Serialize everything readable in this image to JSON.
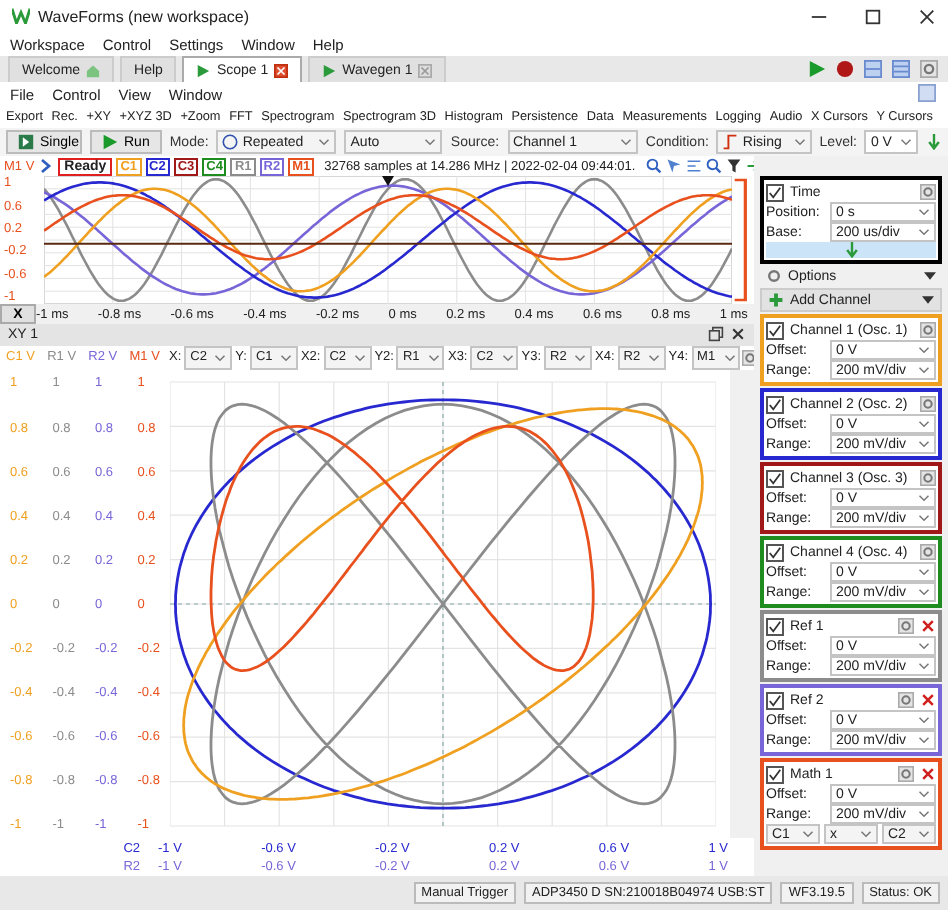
{
  "window": {
    "title": "WaveForms (new workspace)"
  },
  "menu": [
    "Workspace",
    "Control",
    "Settings",
    "Window",
    "Help"
  ],
  "tabs": [
    {
      "label": "Welcome",
      "kind": "home",
      "selected": false
    },
    {
      "label": "Help",
      "kind": "plain",
      "selected": false
    },
    {
      "label": "Scope 1",
      "kind": "instrument",
      "selected": true
    },
    {
      "label": "Wavegen 1",
      "kind": "instrument",
      "selected": false
    }
  ],
  "scope_menu": [
    "File",
    "Control",
    "View",
    "Window"
  ],
  "toolbar": [
    "Export",
    "Rec.",
    "+XY",
    "+XYZ 3D",
    "+Zoom",
    "FFT",
    "Spectrogram",
    "Spectrogram 3D",
    "Histogram",
    "Persistence",
    "Data",
    "Measurements",
    "Logging",
    "Audio",
    "X Cursors",
    "Y Cursors"
  ],
  "controls": {
    "single": "Single",
    "run": "Run",
    "mode_label": "Mode:",
    "mode": "Repeated",
    "trigger": "Auto",
    "source_label": "Source:",
    "source": "Channel 1",
    "condition_label": "Condition:",
    "condition": "Rising",
    "level_label": "Level:",
    "level": "0 V"
  },
  "channel_bar": {
    "axis_label": "M1 V",
    "state": "Ready",
    "info": "32768 samples at 14.286 MHz | 2022-02-04 09:44:01.",
    "channels": [
      {
        "label": "C1",
        "color": "#f0a020"
      },
      {
        "label": "C2",
        "color": "#2828d0"
      },
      {
        "label": "C3",
        "color": "#a01818"
      },
      {
        "label": "C4",
        "color": "#1e8c1e"
      },
      {
        "label": "R1",
        "color": "#8c8c8c"
      },
      {
        "label": "R2",
        "color": "#7866d8"
      },
      {
        "label": "M1",
        "color": "#e8501e"
      }
    ]
  },
  "scope": {
    "y_ticks": [
      "1",
      "0.6",
      "0.2",
      "-0.2",
      "-0.6",
      "-1"
    ],
    "x_axis_button": "X",
    "x_ticks": [
      "-1 ms",
      "-0.8 ms",
      "-0.6 ms",
      "-0.4 ms",
      "-0.2 ms",
      "0 ms",
      "0.2 ms",
      "0.4 ms",
      "0.6 ms",
      "0.8 ms",
      "1 ms"
    ]
  },
  "xy": {
    "title": "XY 1",
    "y_columns": [
      {
        "label": "C1 V",
        "color": "#f0a020",
        "ticks": [
          "1",
          "0.8",
          "0.6",
          "0.4",
          "0.2",
          "0",
          "-0.2",
          "-0.4",
          "-0.6",
          "-0.8",
          "-1"
        ]
      },
      {
        "label": "R1 V",
        "color": "#8c8c8c",
        "ticks": [
          "1",
          "0.8",
          "0.6",
          "0.4",
          "0.2",
          "0",
          "-0.2",
          "-0.4",
          "-0.6",
          "-0.8",
          "-1"
        ]
      },
      {
        "label": "R2 V",
        "color": "#7866d8",
        "ticks": [
          "1",
          "0.8",
          "0.6",
          "0.4",
          "0.2",
          "0",
          "-0.2",
          "-0.4",
          "-0.6",
          "-0.8",
          "-1"
        ]
      },
      {
        "label": "M1 V",
        "color": "#e8501e",
        "ticks": [
          "1",
          "0.8",
          "0.6",
          "0.4",
          "0.2",
          "0",
          "-0.2",
          "-0.4",
          "-0.6",
          "-0.8",
          "-1"
        ]
      }
    ],
    "selectors": [
      {
        "label": "X:",
        "value": "C2"
      },
      {
        "label": "Y:",
        "value": "C1"
      },
      {
        "label": "X2:",
        "value": "C2"
      },
      {
        "label": "Y2:",
        "value": "R1"
      },
      {
        "label": "X3:",
        "value": "C2"
      },
      {
        "label": "Y3:",
        "value": "R2"
      },
      {
        "label": "X4:",
        "value": "R2"
      },
      {
        "label": "Y4:",
        "value": "M1"
      }
    ],
    "x_axes": [
      {
        "label": "C2",
        "color": "#2828d0",
        "ticks": [
          "-1 V",
          "-0.6 V",
          "-0.2 V",
          "0.2 V",
          "0.6 V",
          "1 V"
        ]
      },
      {
        "label": "R2",
        "color": "#7866d8",
        "ticks": [
          "-1 V",
          "-0.6 V",
          "-0.2 V",
          "0.2 V",
          "0.6 V",
          "1 V"
        ]
      }
    ]
  },
  "panel": {
    "time": {
      "title": "Time",
      "checked": true,
      "position_label": "Position:",
      "position": "0 s",
      "base_label": "Base:",
      "base": "200 us/div"
    },
    "options": "Options",
    "add_channel": "Add Channel",
    "channels": [
      {
        "kind": "channel",
        "title": "Channel 1 (Osc. 1)",
        "checked": true,
        "color": "#f0a020",
        "offset_label": "Offset:",
        "offset": "0 V",
        "range_label": "Range:",
        "range": "200 mV/div"
      },
      {
        "kind": "channel",
        "title": "Channel 2 (Osc. 2)",
        "checked": true,
        "color": "#2828d0",
        "offset_label": "Offset:",
        "offset": "0 V",
        "range_label": "Range:",
        "range": "200 mV/div"
      },
      {
        "kind": "channel",
        "title": "Channel 3 (Osc. 3)",
        "checked": true,
        "color": "#a01818",
        "offset_label": "Offset:",
        "offset": "0 V",
        "range_label": "Range:",
        "range": "200 mV/div"
      },
      {
        "kind": "channel",
        "title": "Channel 4 (Osc. 4)",
        "checked": true,
        "color": "#1e8c1e",
        "offset_label": "Offset:",
        "offset": "0 V",
        "range_label": "Range:",
        "range": "200 mV/div"
      },
      {
        "kind": "ref",
        "title": "Ref 1",
        "checked": true,
        "color": "#8c8c8c",
        "offset_label": "Offset:",
        "offset": "0 V",
        "range_label": "Range:",
        "range": "200 mV/div"
      },
      {
        "kind": "ref",
        "title": "Ref 2",
        "checked": true,
        "color": "#7866d8",
        "offset_label": "Offset:",
        "offset": "0 V",
        "range_label": "Range:",
        "range": "200 mV/div"
      },
      {
        "kind": "math",
        "title": "Math 1",
        "checked": true,
        "color": "#e8501e",
        "offset_label": "Offset:",
        "offset": "0 V",
        "range_label": "Range:",
        "range": "200 mV/div",
        "operands": [
          "C1",
          "x",
          "C2"
        ]
      }
    ]
  },
  "status_bar": {
    "trigger": "Manual Trigger",
    "device": "ADP3450 D SN:210018B04974 USB:ST",
    "version": "WF3.19.5",
    "status": "Status: OK"
  }
}
